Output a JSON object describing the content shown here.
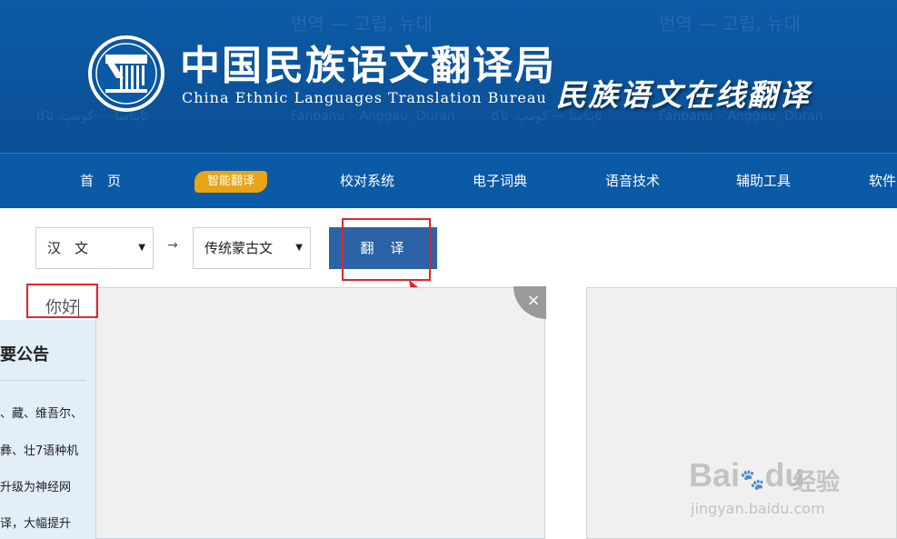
{
  "header": {
    "title_cn": "中国民族语文翻译局",
    "title_en": "China Ethnic Languages Translation Bureau",
    "title_online": "民族语文在线翻译",
    "bg_scripts": [
      "번역 — 고립, 뉴대",
      "Fanbanu – Anggau, Duran",
      "ئاپتاسا — كومپ، ئاڭا",
      "번역 — 고립, 뉴대",
      "Fanbanu – Anggau, Duran",
      "ئاپتاسا — كومپ، ئاڭا"
    ]
  },
  "nav": {
    "items": [
      "首　页",
      "智能翻译",
      "校对系统",
      "电子词典",
      "语音技术",
      "辅助工具",
      "软件"
    ],
    "active_index": 1,
    "active_color": "#e8a316"
  },
  "controls": {
    "source_lang": "汉　文",
    "target_lang": "传统蒙古文",
    "arrow": "→",
    "translate_label": "翻译",
    "dropdown_icon": "▼"
  },
  "editor": {
    "source_text": "你好",
    "clear_icon": "×"
  },
  "notice": {
    "title": "要公告",
    "lines": [
      "、藏、维吾尔、",
      "彝、壮7语种机",
      "升级为神经网",
      "译，大幅提升"
    ]
  },
  "watermark": {
    "brand": "Bai",
    "brand2": "du",
    "brand_cn": "经验",
    "url": "jingyan.baidu.com"
  },
  "colors": {
    "banner": "#0a5aa5",
    "button": "#2b63a6",
    "annotation": "#e0262a"
  }
}
